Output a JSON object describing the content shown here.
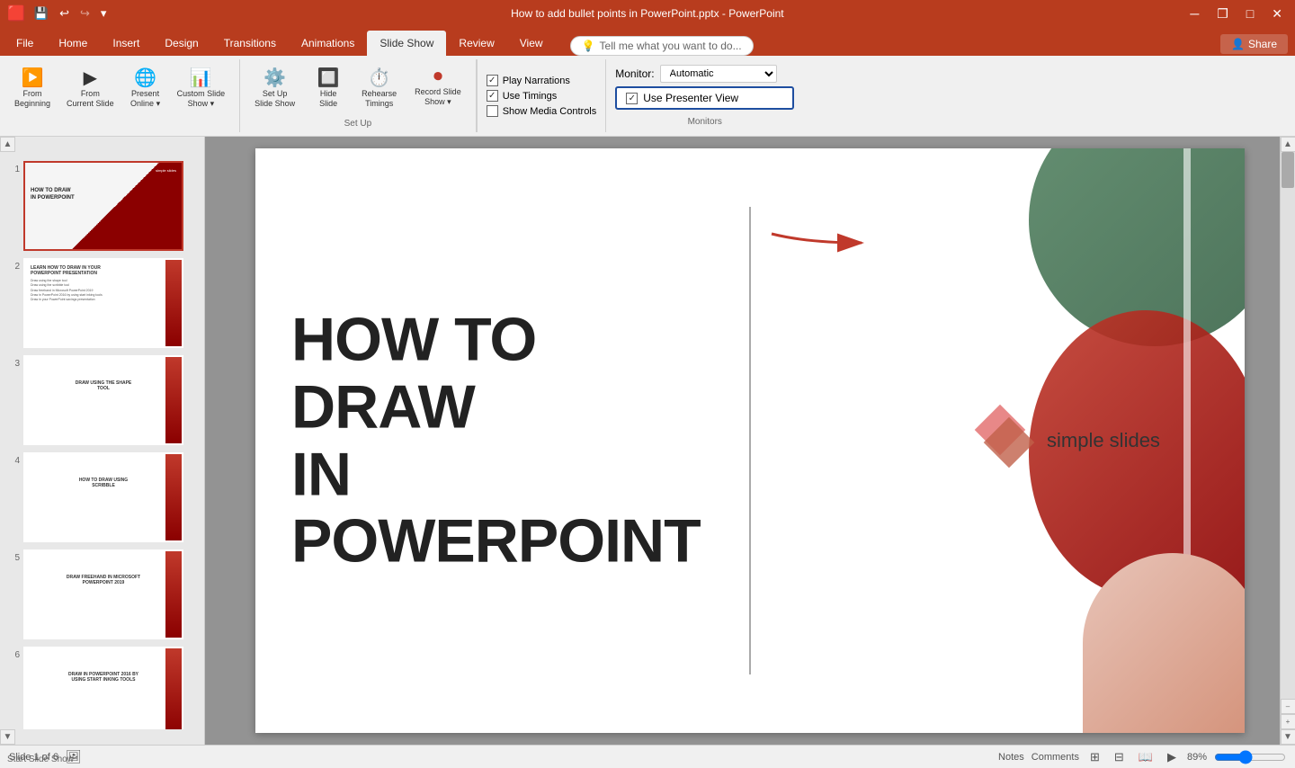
{
  "window": {
    "title": "How to add bullet points in PowerPoint.pptx - PowerPoint",
    "min_btn": "─",
    "max_btn": "□",
    "close_btn": "✕",
    "restore_btn": "❐"
  },
  "quick_access": {
    "save": "💾",
    "undo": "↩",
    "redo": "↪",
    "customize": "▾"
  },
  "tabs": [
    {
      "id": "file",
      "label": "File"
    },
    {
      "id": "home",
      "label": "Home"
    },
    {
      "id": "insert",
      "label": "Insert"
    },
    {
      "id": "design",
      "label": "Design"
    },
    {
      "id": "transitions",
      "label": "Transitions"
    },
    {
      "id": "animations",
      "label": "Animations"
    },
    {
      "id": "slideshow",
      "label": "Slide Show",
      "active": true
    },
    {
      "id": "review",
      "label": "Review"
    },
    {
      "id": "view",
      "label": "View"
    }
  ],
  "share_label": "Share",
  "ribbon": {
    "start_slideshow": {
      "label": "Start Slide Show",
      "items": [
        {
          "id": "from-beginning",
          "icon": "▶",
          "label": "From\nBeginning"
        },
        {
          "id": "from-current",
          "icon": "▶",
          "label": "From\nCurrent Slide"
        },
        {
          "id": "present-online",
          "icon": "🌐",
          "label": "Present\nOnline ▾"
        },
        {
          "id": "custom-slide-show",
          "icon": "📊",
          "label": "Custom Slide\nShow ▾"
        }
      ]
    },
    "setup": {
      "label": "Set Up",
      "items": [
        {
          "id": "setup-slideshow",
          "icon": "⚙",
          "label": "Set Up\nSlide Show"
        },
        {
          "id": "hide-slide",
          "icon": "🔲",
          "label": "Hide\nSlide"
        },
        {
          "id": "rehearse-timings",
          "icon": "⏱",
          "label": "Rehearse\nTimings"
        },
        {
          "id": "record-slide-show",
          "icon": "⏺",
          "label": "Record Slide\nShow ▾"
        }
      ]
    },
    "captions": {
      "label": "",
      "items": [
        {
          "id": "play-narrations",
          "label": "Play Narrations",
          "checked": true
        },
        {
          "id": "use-timings",
          "label": "Use Timings",
          "checked": true
        },
        {
          "id": "show-media-controls",
          "label": "Show Media Controls",
          "checked": false
        }
      ]
    },
    "monitors": {
      "label": "Monitors",
      "monitor_label": "Monitor:",
      "monitor_value": "Automatic",
      "presenter_view_label": "Use Presenter View",
      "presenter_view_checked": true
    }
  },
  "tell_me": "Tell me what you want to do...",
  "slides": [
    {
      "num": 1,
      "active": true,
      "title": "HOW TO DRAW\nIN POWERPOINT",
      "subtitle": ""
    },
    {
      "num": 2,
      "title": "LEARN HOW TO DRAW IN YOUR POWERPOINT PRESENTATION",
      "body": "Draw using the shape tool\nDraw using the scribble tool\nDraw freehand in Microsoft PowerPoint 2019\nDraw in PowerPoint 2016 by using start inking tools\nDraw in your PowerPoint savings presentation"
    },
    {
      "num": 3,
      "title": "DRAW USING THE SHAPE TOOL",
      "body": ""
    },
    {
      "num": 4,
      "title": "HOW TO DRAW USING SCRIBBLE",
      "body": ""
    },
    {
      "num": 5,
      "title": "DRAW FREEHAND IN MICROSOFT POWERPOINT 2019",
      "body": ""
    },
    {
      "num": 6,
      "title": "DRAW IN POWERPOINT 2016 BY USING START INKING TOOLS",
      "body": ""
    }
  ],
  "main_slide": {
    "title_line1": "HOW TO DRAW",
    "title_line2": "IN POWERPOINT",
    "logo_text": "simple slides"
  },
  "status": {
    "slide_info": "Slide 1 of 6",
    "notes_label": "Notes",
    "comments_label": "Comments",
    "zoom_level": "89%"
  }
}
